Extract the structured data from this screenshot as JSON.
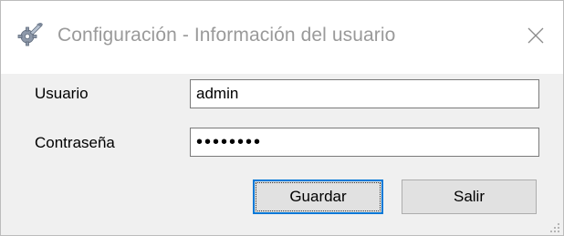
{
  "window": {
    "title": "Configuración - Información del usuario",
    "app_icon": "gear-wrench-icon",
    "close_icon": "close-icon"
  },
  "form": {
    "user_label": "Usuario",
    "user_value": "admin",
    "password_label": "Contraseña",
    "password_value": "••••••••"
  },
  "buttons": {
    "save_label": "Guardar",
    "exit_label": "Salir"
  },
  "colors": {
    "accent": "#0078d7",
    "window_bg": "#f0f0f0",
    "title_text": "#9a9a9a"
  }
}
